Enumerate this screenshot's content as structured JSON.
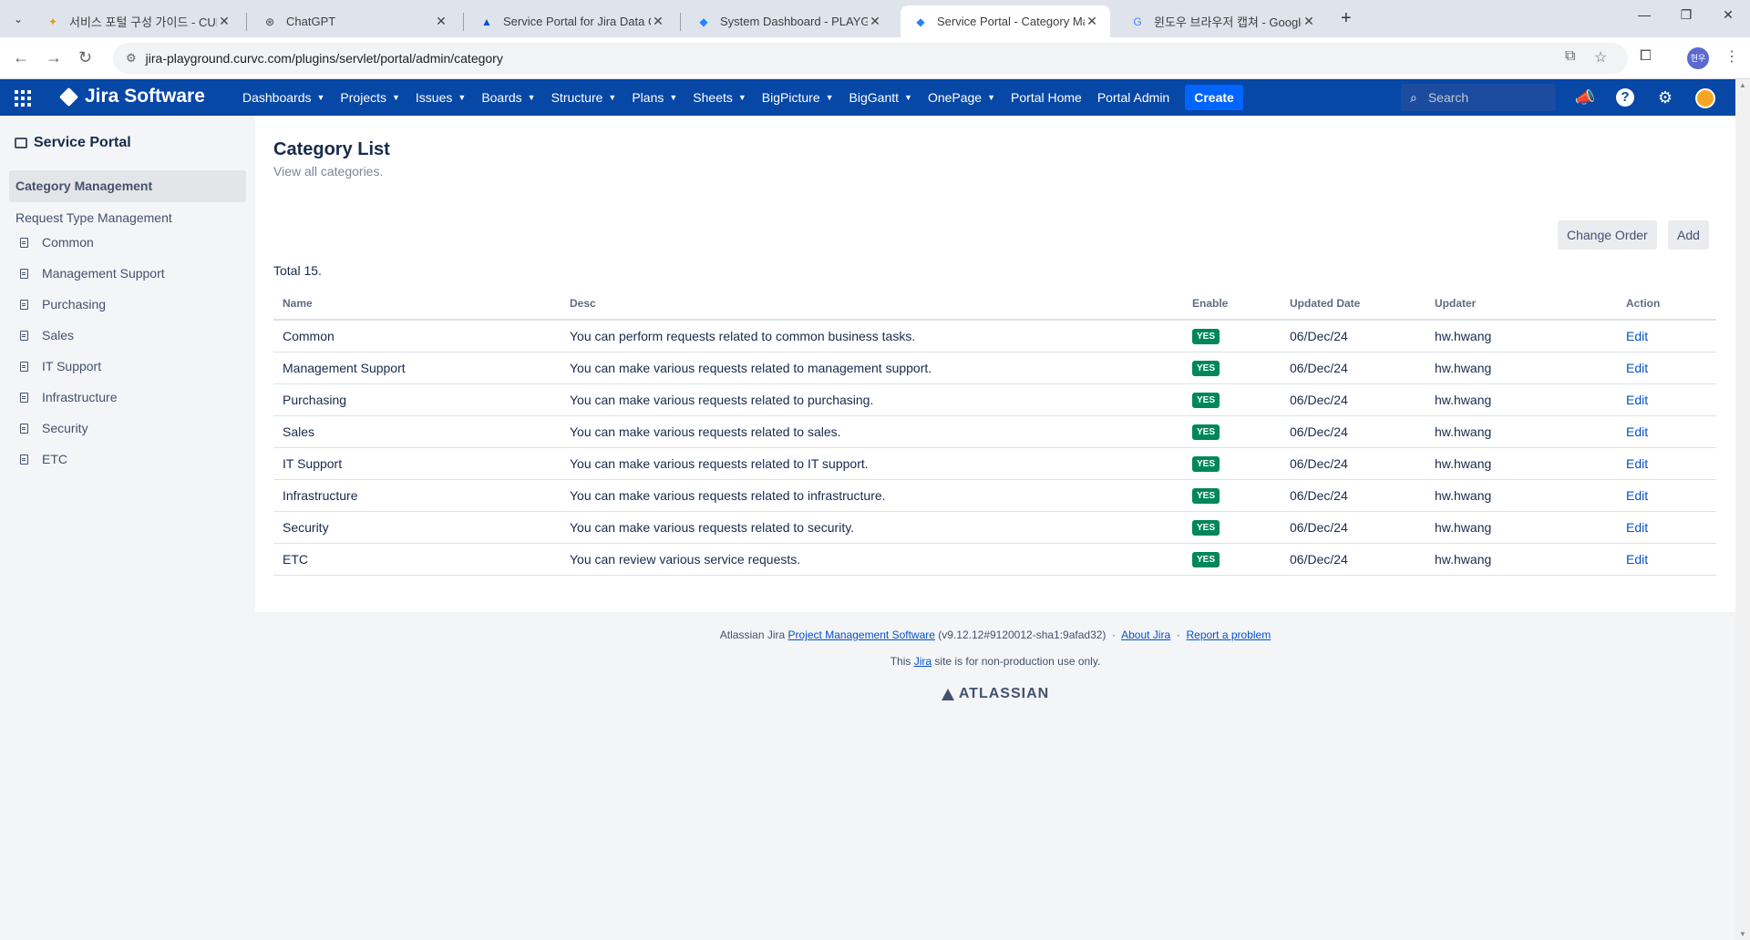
{
  "browser": {
    "tabs": [
      {
        "title": "서비스 포털 구성 가이드 - CUR",
        "favicon": "confluence-icon"
      },
      {
        "title": "ChatGPT",
        "favicon": "chatgpt-icon"
      },
      {
        "title": "Service Portal for Jira Data Center",
        "favicon": "atlassian-icon"
      },
      {
        "title": "System Dashboard - PLAYGROUND",
        "favicon": "jira-icon"
      },
      {
        "title": "Service Portal - Category Management",
        "favicon": "jira-icon"
      },
      {
        "title": "윈도우 브라우저 캡쳐 - Google",
        "favicon": "google-icon"
      }
    ],
    "url": "jira-playground.curvc.com/plugins/servlet/portal/admin/category",
    "profile_initials": "현우"
  },
  "header": {
    "product": "Jira Software",
    "nav": [
      {
        "label": "Dashboards",
        "dropdown": true
      },
      {
        "label": "Projects",
        "dropdown": true
      },
      {
        "label": "Issues",
        "dropdown": true
      },
      {
        "label": "Boards",
        "dropdown": true
      },
      {
        "label": "Structure",
        "dropdown": true
      },
      {
        "label": "Plans",
        "dropdown": true
      },
      {
        "label": "Sheets",
        "dropdown": true
      },
      {
        "label": "BigPicture",
        "dropdown": true
      },
      {
        "label": "BigGantt",
        "dropdown": true
      },
      {
        "label": "OnePage",
        "dropdown": true
      },
      {
        "label": "Portal Home",
        "dropdown": false
      },
      {
        "label": "Portal Admin",
        "dropdown": false
      }
    ],
    "create_label": "Create",
    "search_placeholder": "Search",
    "colors": {
      "header_bg": "#0747a6",
      "create_bg": "#0065ff"
    }
  },
  "sidebar": {
    "title": "Service Portal",
    "active_item": "Category Management",
    "link": "Request Type Management",
    "categories": [
      "Common",
      "Management Support",
      "Purchasing",
      "Sales",
      "IT Support",
      "Infrastructure",
      "Security",
      "ETC"
    ]
  },
  "main": {
    "title": "Category List",
    "subtitle": "View all categories.",
    "buttons": {
      "change_order": "Change Order",
      "add": "Add"
    },
    "total": "Total 15.",
    "columns": [
      "Name",
      "Desc",
      "Enable",
      "Updated Date",
      "Updater",
      "Action"
    ],
    "rows": [
      {
        "name": "Common",
        "desc": "You can perform requests related to common business tasks.",
        "enable": "YES",
        "date": "06/Dec/24",
        "updater": "hw.hwang",
        "action": "Edit"
      },
      {
        "name": "Management Support",
        "desc": "You can make various requests related to management support.",
        "enable": "YES",
        "date": "06/Dec/24",
        "updater": "hw.hwang",
        "action": "Edit"
      },
      {
        "name": "Purchasing",
        "desc": "You can make various requests related to purchasing.",
        "enable": "YES",
        "date": "06/Dec/24",
        "updater": "hw.hwang",
        "action": "Edit"
      },
      {
        "name": "Sales",
        "desc": "You can make various requests related to sales.",
        "enable": "YES",
        "date": "06/Dec/24",
        "updater": "hw.hwang",
        "action": "Edit"
      },
      {
        "name": "IT Support",
        "desc": "You can make various requests related to IT support.",
        "enable": "YES",
        "date": "06/Dec/24",
        "updater": "hw.hwang",
        "action": "Edit"
      },
      {
        "name": "Infrastructure",
        "desc": "You can make various requests related to infrastructure.",
        "enable": "YES",
        "date": "06/Dec/24",
        "updater": "hw.hwang",
        "action": "Edit"
      },
      {
        "name": "Security",
        "desc": "You can make various requests related to security.",
        "enable": "YES",
        "date": "06/Dec/24",
        "updater": "hw.hwang",
        "action": "Edit"
      },
      {
        "name": "ETC",
        "desc": "You can review various service requests.",
        "enable": "YES",
        "date": "06/Dec/24",
        "updater": "hw.hwang",
        "action": "Edit"
      }
    ],
    "colors": {
      "enable_badge": "#00875a",
      "link": "#0052cc"
    }
  },
  "footer": {
    "prefix": "Atlassian Jira",
    "product_link": "Project Management Software",
    "version": "(v9.12.12#9120012-sha1:9afad32)",
    "about": "About Jira",
    "report": "Report a problem",
    "note_before": "This",
    "note_link": "Jira",
    "note_after": "site is for non-production use only.",
    "brand": "ATLASSIAN"
  }
}
